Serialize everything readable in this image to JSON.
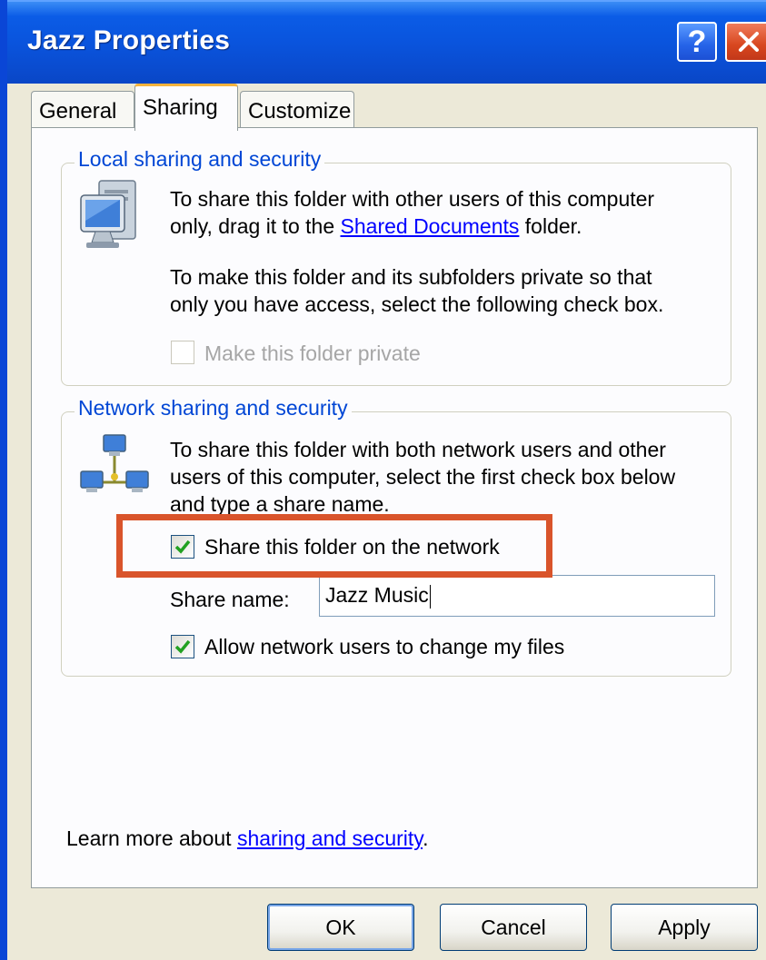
{
  "window": {
    "title": "Jazz Properties",
    "help_icon": "question-mark",
    "close_icon": "x"
  },
  "tabs": [
    {
      "label": "General"
    },
    {
      "label": "Sharing",
      "selected": true
    },
    {
      "label": "Customize"
    }
  ],
  "local": {
    "legend": "Local sharing and security",
    "icon": "computer-icon",
    "text1": "To share this folder with other users of this computer",
    "text2_prefix": "only, drag it to the ",
    "text2_link": "Shared Documents",
    "text2_suffix": " folder.",
    "text3": "To make this folder and its subfolders private so that",
    "text4": "only you have access, select the following check box.",
    "private_label": "Make this folder private",
    "private_checked": false,
    "private_enabled": false
  },
  "network": {
    "legend": "Network sharing and security",
    "icon": "network-computers-icon",
    "text1": "To share this folder with both network users and other",
    "text2": "users of this computer, select the first check box below",
    "text3": "and type a share name.",
    "share_label": "Share this folder on the network",
    "share_checked": true,
    "share_name_label": "Share name:",
    "share_name_value": "Jazz Music",
    "allow_label": "Allow network users to change my files",
    "allow_checked": true
  },
  "footer": {
    "learn_prefix": "Learn more about ",
    "learn_link": "sharing and security",
    "learn_suffix": "."
  },
  "buttons": {
    "ok": "OK",
    "cancel": "Cancel",
    "apply": "Apply"
  },
  "colors": {
    "title_bar": "#0a54dd",
    "legend_text": "#0046d5",
    "link": "#0000ff",
    "highlight_box": "#d9542b",
    "checkmark": "#21a121"
  }
}
